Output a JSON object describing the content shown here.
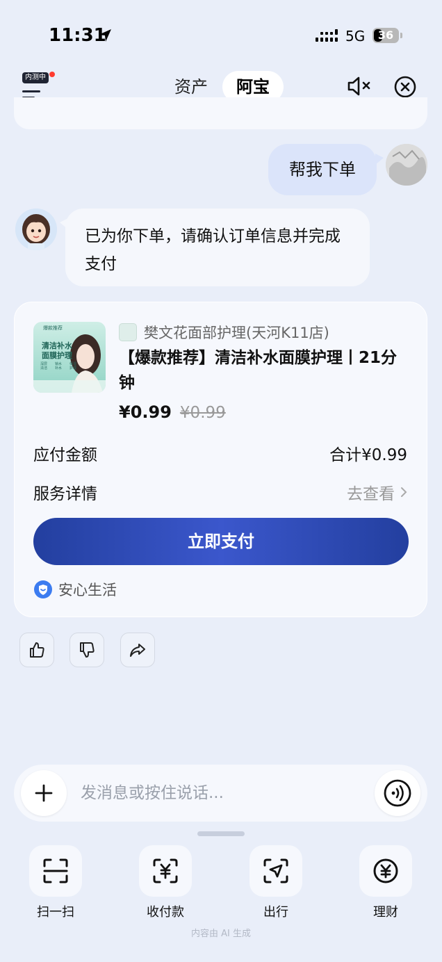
{
  "status_bar": {
    "time": "11:31",
    "network": "5G",
    "battery": "36"
  },
  "header": {
    "beta_badge": "内测中",
    "tabs": [
      {
        "label": "资产"
      },
      {
        "label": "阿宝",
        "active": true
      }
    ],
    "icons": {
      "menu": "menu-icon",
      "mute": "speaker-mute-icon",
      "close": "close-circle-icon"
    }
  },
  "conversation": {
    "user_message": "帮我下单",
    "bot_message": "已为你下单，请确认订单信息并完成支付"
  },
  "order_card": {
    "image_text": {
      "tag": "爆款推荐",
      "headline_line1": "清洁补水",
      "headline_line2": "面膜护理",
      "features": [
        "深层清洁",
        "锁水补水",
        "保湿护理"
      ]
    },
    "shop_name": "樊文花面部护理(天河K11店)",
    "product_title": "【爆款推荐】清洁补水面膜护理丨21分钟",
    "price": "¥0.99",
    "original_price": "¥0.99",
    "amount_label": "应付金额",
    "amount_value": "合计¥0.99",
    "service_label": "服务详情",
    "service_link": "去查看",
    "pay_button": "立即支付",
    "assurance": "安心生活"
  },
  "feedback": {
    "icons": [
      "thumbs-up-icon",
      "thumbs-down-icon",
      "share-icon"
    ]
  },
  "input_bar": {
    "placeholder": "发消息或按住说话..."
  },
  "quick_actions": [
    {
      "label": "扫一扫",
      "icon": "scan-icon"
    },
    {
      "label": "收付款",
      "icon": "payment-icon"
    },
    {
      "label": "出行",
      "icon": "travel-icon"
    },
    {
      "label": "理财",
      "icon": "wealth-icon"
    }
  ],
  "footer_note": "内容由 AI 生成",
  "colors": {
    "background": "#e9eef9",
    "card": "#f6f8fd",
    "user_bubble": "#dbe4fa",
    "pay_button": "#2d48b8",
    "badge_dot": "#ff3b30"
  }
}
